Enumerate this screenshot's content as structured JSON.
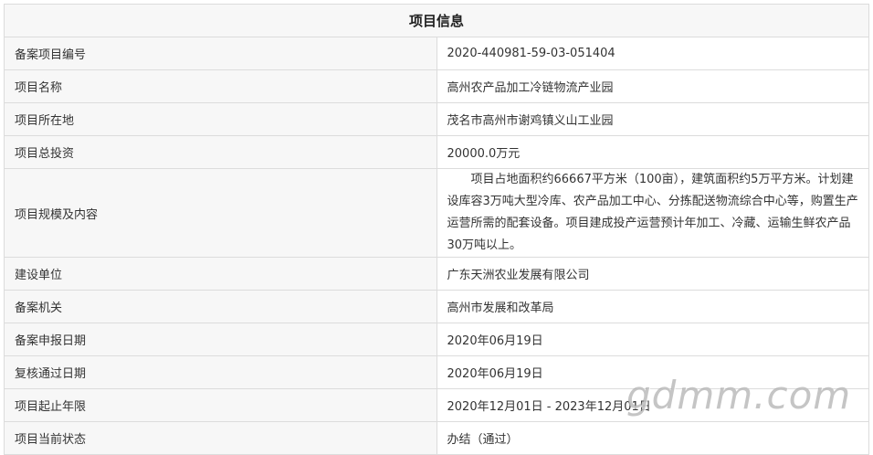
{
  "table": {
    "title": "项目信息",
    "rows": [
      {
        "label": "备案项目编号",
        "value": "2020-440981-59-03-051404"
      },
      {
        "label": "项目名称",
        "value": "高州农产品加工冷链物流产业园"
      },
      {
        "label": "项目所在地",
        "value": "茂名市高州市谢鸡镇义山工业园"
      },
      {
        "label": "项目总投资",
        "value": "20000.0万元"
      },
      {
        "label": "项目规模及内容",
        "value": "项目占地面积约66667平方米（100亩），建筑面积约5万平方米。计划建设库容3万吨大型冷库、农产品加工中心、分拣配送物流综合中心等，购置生产运营所需的配套设备。项目建成投产运营预计年加工、冷藏、运输生鲜农产品30万吨以上。"
      },
      {
        "label": "建设单位",
        "value": "广东天洲农业发展有限公司"
      },
      {
        "label": "备案机关",
        "value": "高州市发展和改革局"
      },
      {
        "label": "备案申报日期",
        "value": "2020年06月19日"
      },
      {
        "label": "复核通过日期",
        "value": "2020年06月19日"
      },
      {
        "label": "项目起止年限",
        "value": "2020年12月01日 - 2023年12月01日"
      },
      {
        "label": "项目当前状态",
        "value": "办结（通过）"
      }
    ]
  },
  "watermark": "gdmm.com"
}
